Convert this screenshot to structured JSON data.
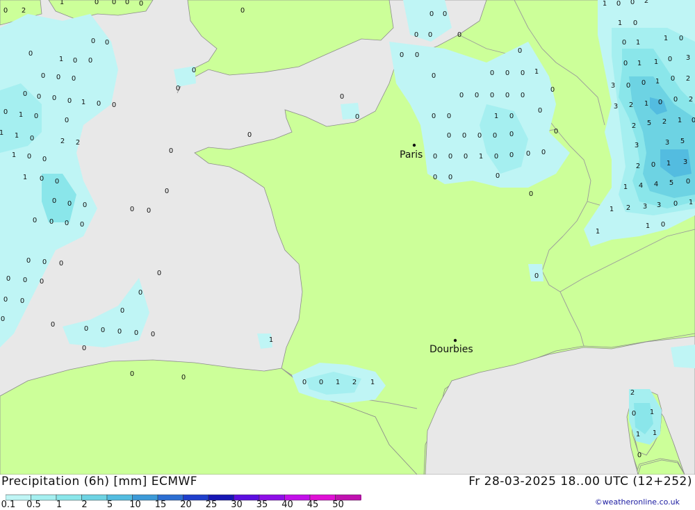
{
  "title": "Precipitation (6h) [mm] ECMWF",
  "timestamp": "Fr 28-03-2025 18..00 UTC (12+252)",
  "credit": "©weatheronline.co.uk",
  "colors": {
    "sea": "#e8e8e8",
    "land": "#ccff99",
    "border": "#9a9a9a",
    "coast": "#8c8c8c"
  },
  "legend": {
    "labels": [
      "0.1",
      "0.5",
      "1",
      "2",
      "5",
      "10",
      "15",
      "20",
      "25",
      "30",
      "35",
      "40",
      "45",
      "50"
    ],
    "colors": [
      "#bff5f5",
      "#a5eff0",
      "#8ae6ea",
      "#6dd3e3",
      "#53bce0",
      "#3c9ad8",
      "#2c6ed2",
      "#1f3fcc",
      "#1616b4",
      "#5b0ee0",
      "#8e0ee8",
      "#c20fea",
      "#e010d6",
      "#c010b0"
    ]
  },
  "cities": [
    {
      "name": "Paris"
    },
    {
      "name": "Dourbies"
    }
  ],
  "values": [
    "0",
    "2",
    "1",
    "0",
    "0",
    "0",
    "0",
    "0",
    "0",
    "0",
    "0",
    "1",
    "0",
    "0",
    "0",
    "0",
    "0",
    "0",
    "0",
    "0",
    "0",
    "1",
    "0",
    "0",
    "0",
    "1",
    "0",
    "0",
    "1",
    "1",
    "0",
    "2",
    "2",
    "1",
    "0",
    "0",
    "1",
    "0",
    "0",
    "0",
    "0",
    "0",
    "0",
    "0",
    "0",
    "0",
    "0",
    "0",
    "0",
    "0",
    "0",
    "0",
    "0",
    "0",
    "0",
    "0",
    "0",
    "0",
    "0",
    "0",
    "0",
    "0",
    "0",
    "0",
    "0",
    "0",
    "0",
    "0",
    "0",
    "0",
    "1",
    "0",
    "0",
    "0",
    "0",
    "0",
    "0",
    "0",
    "0",
    "0",
    "0",
    "0",
    "0",
    "0",
    "0",
    "0",
    "0",
    "0",
    "0",
    "0",
    "0",
    "0",
    "0",
    "1",
    "0",
    "0",
    "0",
    "0",
    "0",
    "0",
    "1",
    "0",
    "0",
    "0",
    "0",
    "0",
    "0",
    "0",
    "0",
    "0",
    "1",
    "0",
    "0",
    "0",
    "0",
    "0",
    "0",
    "0",
    "0",
    "0",
    "0",
    "0",
    "1",
    "2",
    "1",
    "1",
    "0",
    "0",
    "2",
    "1",
    "0",
    "0",
    "1",
    "1",
    "0",
    "0",
    "1",
    "1",
    "0",
    "3",
    "3",
    "0",
    "0",
    "1",
    "0",
    "2",
    "3",
    "2",
    "1",
    "0",
    "0",
    "2",
    "2",
    "5",
    "2",
    "1",
    "0",
    "3",
    "3",
    "5",
    "2",
    "0",
    "1",
    "3",
    "1",
    "4",
    "4",
    "5",
    "0",
    "1",
    "2",
    "3",
    "3",
    "0",
    "1",
    "1",
    "1",
    "0",
    "2",
    "0",
    "1",
    "1",
    "1",
    "0",
    "0",
    "0",
    "0",
    "0",
    "0",
    "0"
  ]
}
